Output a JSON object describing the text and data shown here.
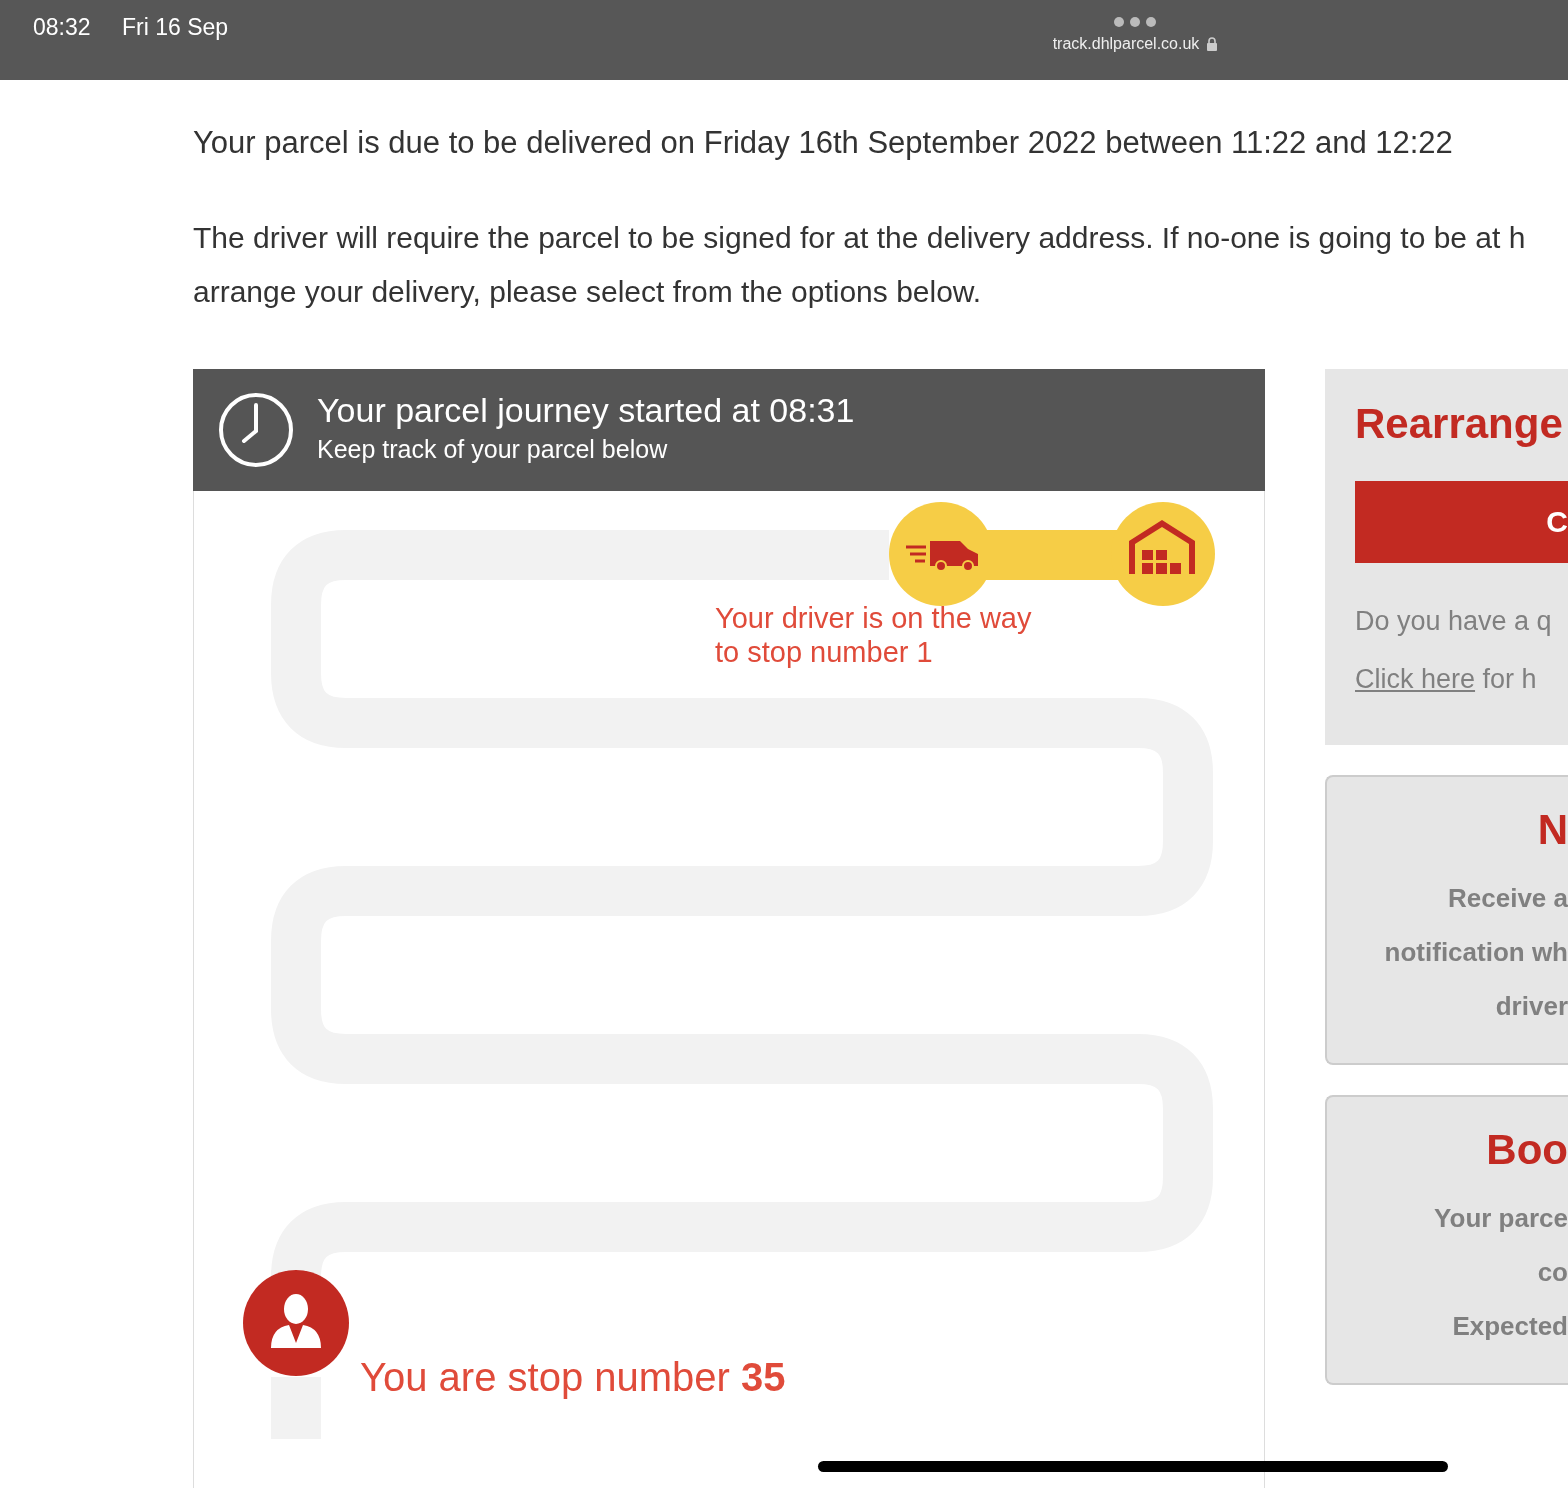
{
  "status_bar": {
    "time": "08:32",
    "date": "Fri 16 Sep",
    "url": "track.dhlparcel.co.uk"
  },
  "delivery_notice": "Your parcel is due to be delivered on Friday 16th September 2022 between 11:22 and 12:22",
  "signature_notice": "The driver will require the parcel to be signed for at the delivery address. If no-one is going to be at h\narrange your delivery, please select from the options below.",
  "journey": {
    "title": "Your parcel journey started at 08:31",
    "subtitle": "Keep track of your parcel below",
    "driver_status": "Your driver is on the way\nto stop number 1",
    "your_stop": "You are stop number **35**"
  },
  "side_panels": [
    {
      "kind": "action",
      "title": "Rearrange",
      "button": "C",
      "question": "Do you have a q",
      "link": "Click here",
      "link_suffix": " for h"
    },
    {
      "kind": "info",
      "title": "N",
      "lines": [
        "Receive a",
        "notification wh",
        "driver"
      ]
    },
    {
      "kind": "info",
      "title": "Boo",
      "lines": [
        "Your parce",
        "co",
        "Expected"
      ]
    }
  ]
}
